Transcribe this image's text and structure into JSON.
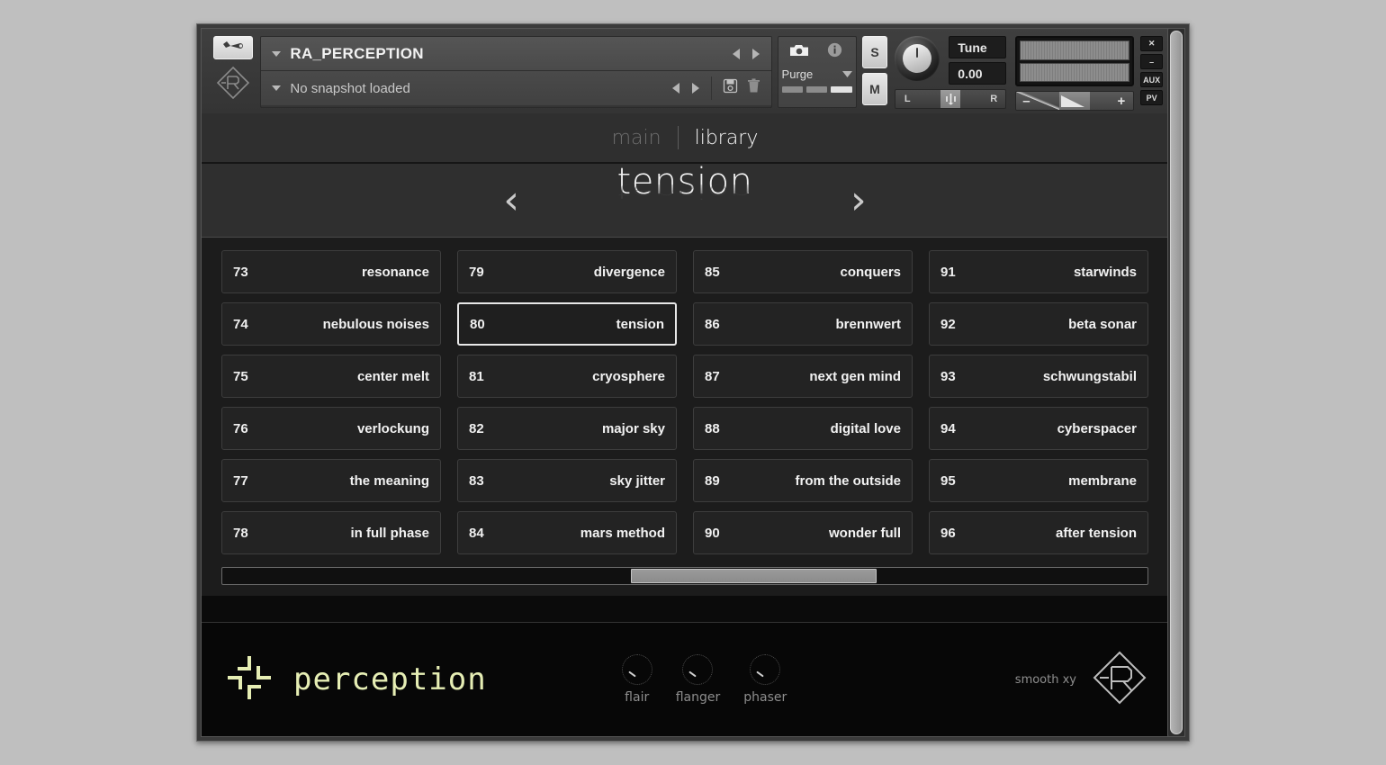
{
  "window": {
    "instrument_name": "RA_PERCEPTION",
    "snapshot_name": "No snapshot loaded",
    "wrench_icon": "wrench-icon",
    "brand_logo_icon": "r-diamond-logo-icon",
    "prev_icon": "triangle-left-icon",
    "next_icon": "triangle-right-icon",
    "save_icon": "floppy-disk-icon",
    "delete_icon": "trash-icon"
  },
  "purge": {
    "camera_icon": "camera-icon",
    "info_icon": "info-icon",
    "label": "Purge",
    "dropdown_icon": "chevron-down-icon",
    "memory_bars": 3
  },
  "channel": {
    "solo_label": "S",
    "mute_label": "M",
    "tune_label": "Tune",
    "tune_value": "0.00",
    "pan_left_label": "L",
    "pan_right_label": "R",
    "volume_minus_label": "–",
    "volume_plus_label": "+"
  },
  "window_buttons": [
    {
      "label": "✕",
      "name": "close-button"
    },
    {
      "label": "–",
      "name": "minimize-button"
    },
    {
      "label": "AUX",
      "name": "aux-button"
    },
    {
      "label": "PV",
      "name": "pv-button"
    }
  ],
  "tabs": [
    {
      "label": "main",
      "active": false
    },
    {
      "label": "library",
      "active": true
    }
  ],
  "preset_header": {
    "prev_arrow": "‹",
    "next_arrow": "›",
    "current_preset": "tension"
  },
  "presets": [
    {
      "num": "73",
      "name": "resonance",
      "selected": false
    },
    {
      "num": "79",
      "name": "divergence",
      "selected": false
    },
    {
      "num": "85",
      "name": "conquers",
      "selected": false
    },
    {
      "num": "91",
      "name": "starwinds",
      "selected": false
    },
    {
      "num": "74",
      "name": "nebulous noises",
      "selected": false
    },
    {
      "num": "80",
      "name": "tension",
      "selected": true
    },
    {
      "num": "86",
      "name": "brennwert",
      "selected": false
    },
    {
      "num": "92",
      "name": "beta sonar",
      "selected": false
    },
    {
      "num": "75",
      "name": "center melt",
      "selected": false
    },
    {
      "num": "81",
      "name": "cryosphere",
      "selected": false
    },
    {
      "num": "87",
      "name": "next gen mind",
      "selected": false
    },
    {
      "num": "93",
      "name": "schwungstabil",
      "selected": false
    },
    {
      "num": "76",
      "name": "verlockung",
      "selected": false
    },
    {
      "num": "82",
      "name": "major sky",
      "selected": false
    },
    {
      "num": "88",
      "name": "digital love",
      "selected": false
    },
    {
      "num": "94",
      "name": "cyberspacer",
      "selected": false
    },
    {
      "num": "77",
      "name": "the meaning",
      "selected": false
    },
    {
      "num": "83",
      "name": "sky jitter",
      "selected": false
    },
    {
      "num": "89",
      "name": "from the outside",
      "selected": false
    },
    {
      "num": "95",
      "name": "membrane",
      "selected": false
    },
    {
      "num": "78",
      "name": "in full phase",
      "selected": false
    },
    {
      "num": "84",
      "name": "mars method",
      "selected": false
    },
    {
      "num": "90",
      "name": "wonder full",
      "selected": false
    },
    {
      "num": "96",
      "name": "after tension",
      "selected": false
    }
  ],
  "scrollbar": {
    "thumb_left_pct": 44.2,
    "thumb_width_pct": 26.5
  },
  "footer": {
    "brand_name": "perception",
    "brand_mark_icon": "perception-pinwheel-icon",
    "fx": [
      {
        "label": "flair"
      },
      {
        "label": "flanger"
      },
      {
        "label": "phaser"
      }
    ],
    "smooth_label": "smooth xy",
    "logo_icon": "r-diamond-logo-icon"
  },
  "colors": {
    "page_background": "#bfbfbf",
    "panel_dark": "#1c1c1c",
    "header_grey": "#3f3f3f",
    "accent_brand": "#e6eeb4",
    "text_primary": "#f2f2f2",
    "text_muted": "#8d8d8d"
  }
}
